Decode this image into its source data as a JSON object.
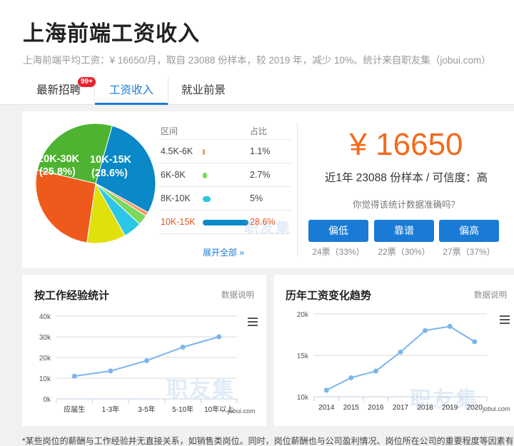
{
  "header": {
    "title": "上海前端工资收入",
    "subtitle": "上海前端平均工资：¥ 16650/月，取自 23088 份样本，较 2019 年，减少 10%。统计来自职友集（jobui.com）"
  },
  "tabs": [
    {
      "label": "最新招聘",
      "badge": "99+"
    },
    {
      "label": "工资收入",
      "active": true
    },
    {
      "label": "就业前景"
    }
  ],
  "distribution": {
    "col_range": "区间",
    "col_ratio": "占比",
    "pie_labels": [
      {
        "range": "10K-15K",
        "pct": "(28.6%)"
      },
      {
        "range": "20K-30K",
        "pct": "(25.8%)"
      }
    ],
    "rows": [
      {
        "range": "4.5K-6K",
        "ratio": "1.1%",
        "value": 1.1,
        "color": "#f4976c"
      },
      {
        "range": "6K-8K",
        "ratio": "2.7%",
        "value": 2.7,
        "color": "#7ad95a"
      },
      {
        "range": "8K-10K",
        "ratio": "5%",
        "value": 5,
        "color": "#2dc6e6"
      },
      {
        "range": "10K-15K",
        "ratio": "28.6%",
        "value": 28.6,
        "color": "#0a88c7",
        "highlight": true
      }
    ],
    "expand_label": "展开全部 »",
    "pie_slices": [
      {
        "label": "10K-15K",
        "value": 28.6,
        "color": "#0a88c7"
      },
      {
        "label": "4.5K-6K",
        "value": 1.1,
        "color": "#f4976c"
      },
      {
        "label": "6K-8K",
        "value": 2.7,
        "color": "#7ad95a"
      },
      {
        "label": "8K-10K",
        "value": 5.0,
        "color": "#2dc6e6"
      },
      {
        "label": "other-yellow",
        "value": 10.5,
        "color": "#e0e00a"
      },
      {
        "label": "other-orange",
        "value": 26.3,
        "color": "#ee5a1c"
      },
      {
        "label": "20K-30K",
        "value": 25.8,
        "color": "#4eb330"
      }
    ]
  },
  "summary": {
    "salary": "¥ 16650",
    "sample": "近1年 23088 份样本 / 可信度：高",
    "question": "你觉得该统计数据准确吗？",
    "votes": [
      {
        "label": "偏低",
        "count": "24票（33%）"
      },
      {
        "label": "靠谱",
        "count": "22票（30%）"
      },
      {
        "label": "偏高",
        "count": "27票（37%）"
      }
    ]
  },
  "experience_chart": {
    "title": "按工作经验统计",
    "note": "数据说明",
    "watermark": "职友集",
    "site": "jobui.com"
  },
  "trend_chart": {
    "title": "历年工资变化趋势",
    "note": "数据说明",
    "watermark": "职友集",
    "site": "jobui.com"
  },
  "footer": "*某些岗位的薪酬与工作经验并无直接关系，如销售类岗位。同时，岗位薪酬也与公司盈利情况、岗位所在公司的重要程度等因素有关。",
  "chart_data": [
    {
      "type": "line",
      "categories": [
        "应届生",
        "1-3年",
        "3-5年",
        "5-10年",
        "10年以上"
      ],
      "values": [
        11000,
        13500,
        18500,
        25000,
        30000
      ],
      "ylim": [
        0,
        40000
      ],
      "yticks": [
        "0k",
        "10k",
        "20k",
        "30k",
        "40k"
      ],
      "color": "#7cb5ec"
    },
    {
      "type": "line",
      "categories": [
        "2014",
        "2015",
        "2016",
        "2017",
        "2018",
        "2019",
        "2020"
      ],
      "values": [
        10800,
        12300,
        13100,
        15400,
        18000,
        18500,
        16650
      ],
      "ylim": [
        10000,
        20000
      ],
      "yticks": [
        "10k",
        "15k",
        "20k"
      ],
      "color": "#7cb5ec"
    }
  ]
}
